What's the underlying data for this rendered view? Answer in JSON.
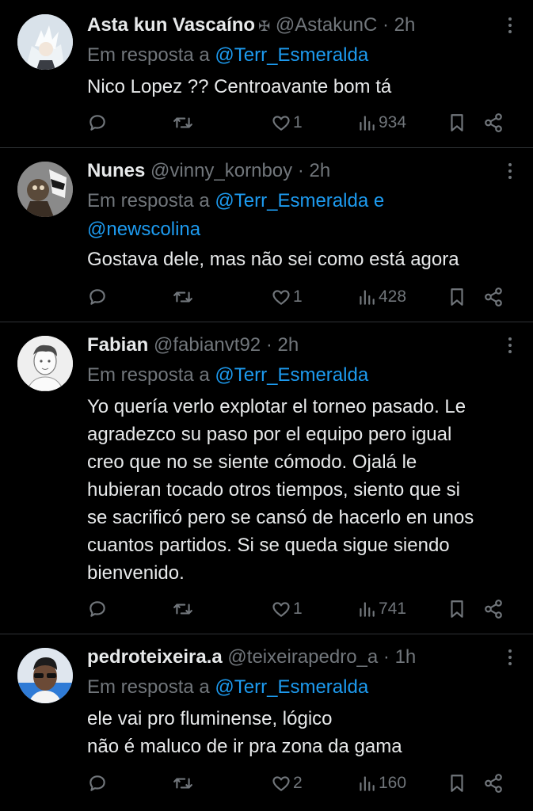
{
  "reply_prefix": "Em resposta a",
  "tweets": [
    {
      "name": "Asta kun Vascaíno",
      "badge": "✠",
      "handle": "@AstakunC",
      "time": "· 2h",
      "reply_to_1": "@Terr_Esmeralda",
      "reply_to_join": "",
      "reply_to_2": "",
      "lines": [
        "Nico Lopez ?? Centroavante bom tá"
      ],
      "likes": "1",
      "views": "934"
    },
    {
      "name": "Nunes",
      "handle": "@vinny_kornboy",
      "time": "· 2h",
      "reply_to_1": "@Terr_Esmeralda e",
      "reply_to_2": "@newscolina",
      "lines": [
        "Gostava dele, mas não sei como está agora"
      ],
      "likes": "1",
      "views": "428"
    },
    {
      "name": "Fabian",
      "handle": "@fabianvt92",
      "time": "· 2h",
      "reply_to_1": "@Terr_Esmeralda",
      "lines": [
        "Yo quería verlo explotar el torneo pasado. Le",
        "agradezco su paso por el equipo pero igual",
        "creo que no se siente cómodo. Ojalá le",
        "hubieran tocado otros tiempos, siento que si",
        "se sacrificó pero se cansó de hacerlo en unos",
        "cuantos partidos. Si se queda sigue siendo",
        "bienvenido."
      ],
      "likes": "1",
      "views": "741"
    },
    {
      "name": "pedroteixeira.a",
      "handle": "@teixeirapedro_a",
      "time": "· 1h",
      "reply_to_1": "@Terr_Esmeralda",
      "lines": [
        "ele vai pro fluminense, lógico",
        "não é maluco de ir pra zona da gama"
      ],
      "likes": "2",
      "views": "160"
    }
  ],
  "icons": {
    "reply": "reply-icon",
    "retweet": "retweet-icon",
    "like": "heart-icon",
    "views": "views-icon",
    "bookmark": "bookmark-icon",
    "share": "share-icon",
    "more": "more-icon"
  },
  "colors": {
    "background": "#000000",
    "link": "#1d9bf0",
    "muted": "#71767b",
    "text": "#e7e9ea"
  }
}
